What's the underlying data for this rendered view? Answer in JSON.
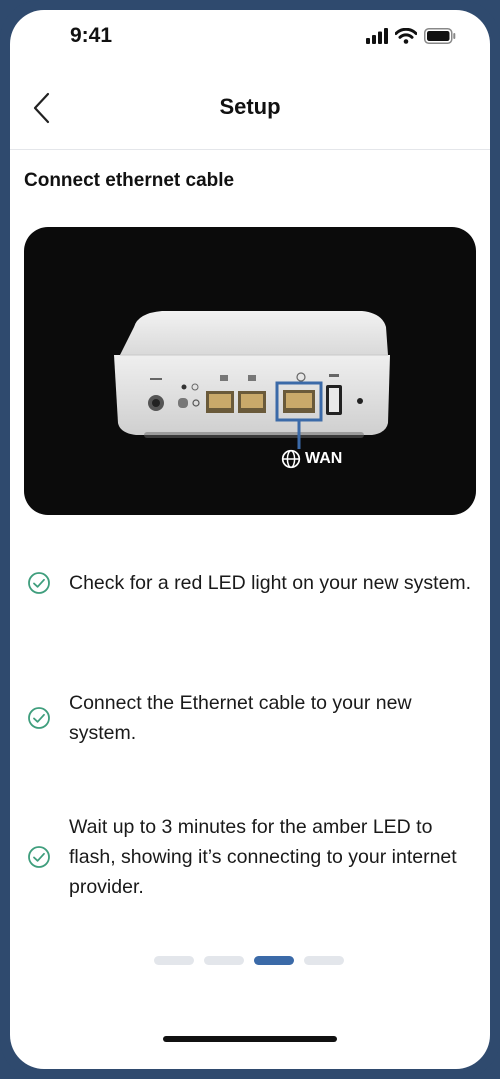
{
  "status_bar": {
    "time": "9:41",
    "icons": [
      "signal-icon",
      "wifi-icon",
      "battery-icon"
    ]
  },
  "nav": {
    "title": "Setup",
    "back_icon": "chevron-left-icon"
  },
  "section_title": "Connect ethernet cable",
  "device_image": {
    "port_label": "WAN",
    "port_icon": "globe-icon",
    "highlight_color": "#3b6aa8"
  },
  "checklist": [
    {
      "text": "Check for a red LED light on your new system."
    },
    {
      "text": "Connect the Ethernet cable to your new system."
    },
    {
      "text": "Wait up to 3 minutes for the amber LED to flash, showing it’s connecting to your internet provider."
    }
  ],
  "pager": {
    "total": 4,
    "current": 3
  },
  "colors": {
    "frame": "#2f4a6e",
    "accent": "#3b6aa8",
    "check": "#3f9e7d"
  }
}
